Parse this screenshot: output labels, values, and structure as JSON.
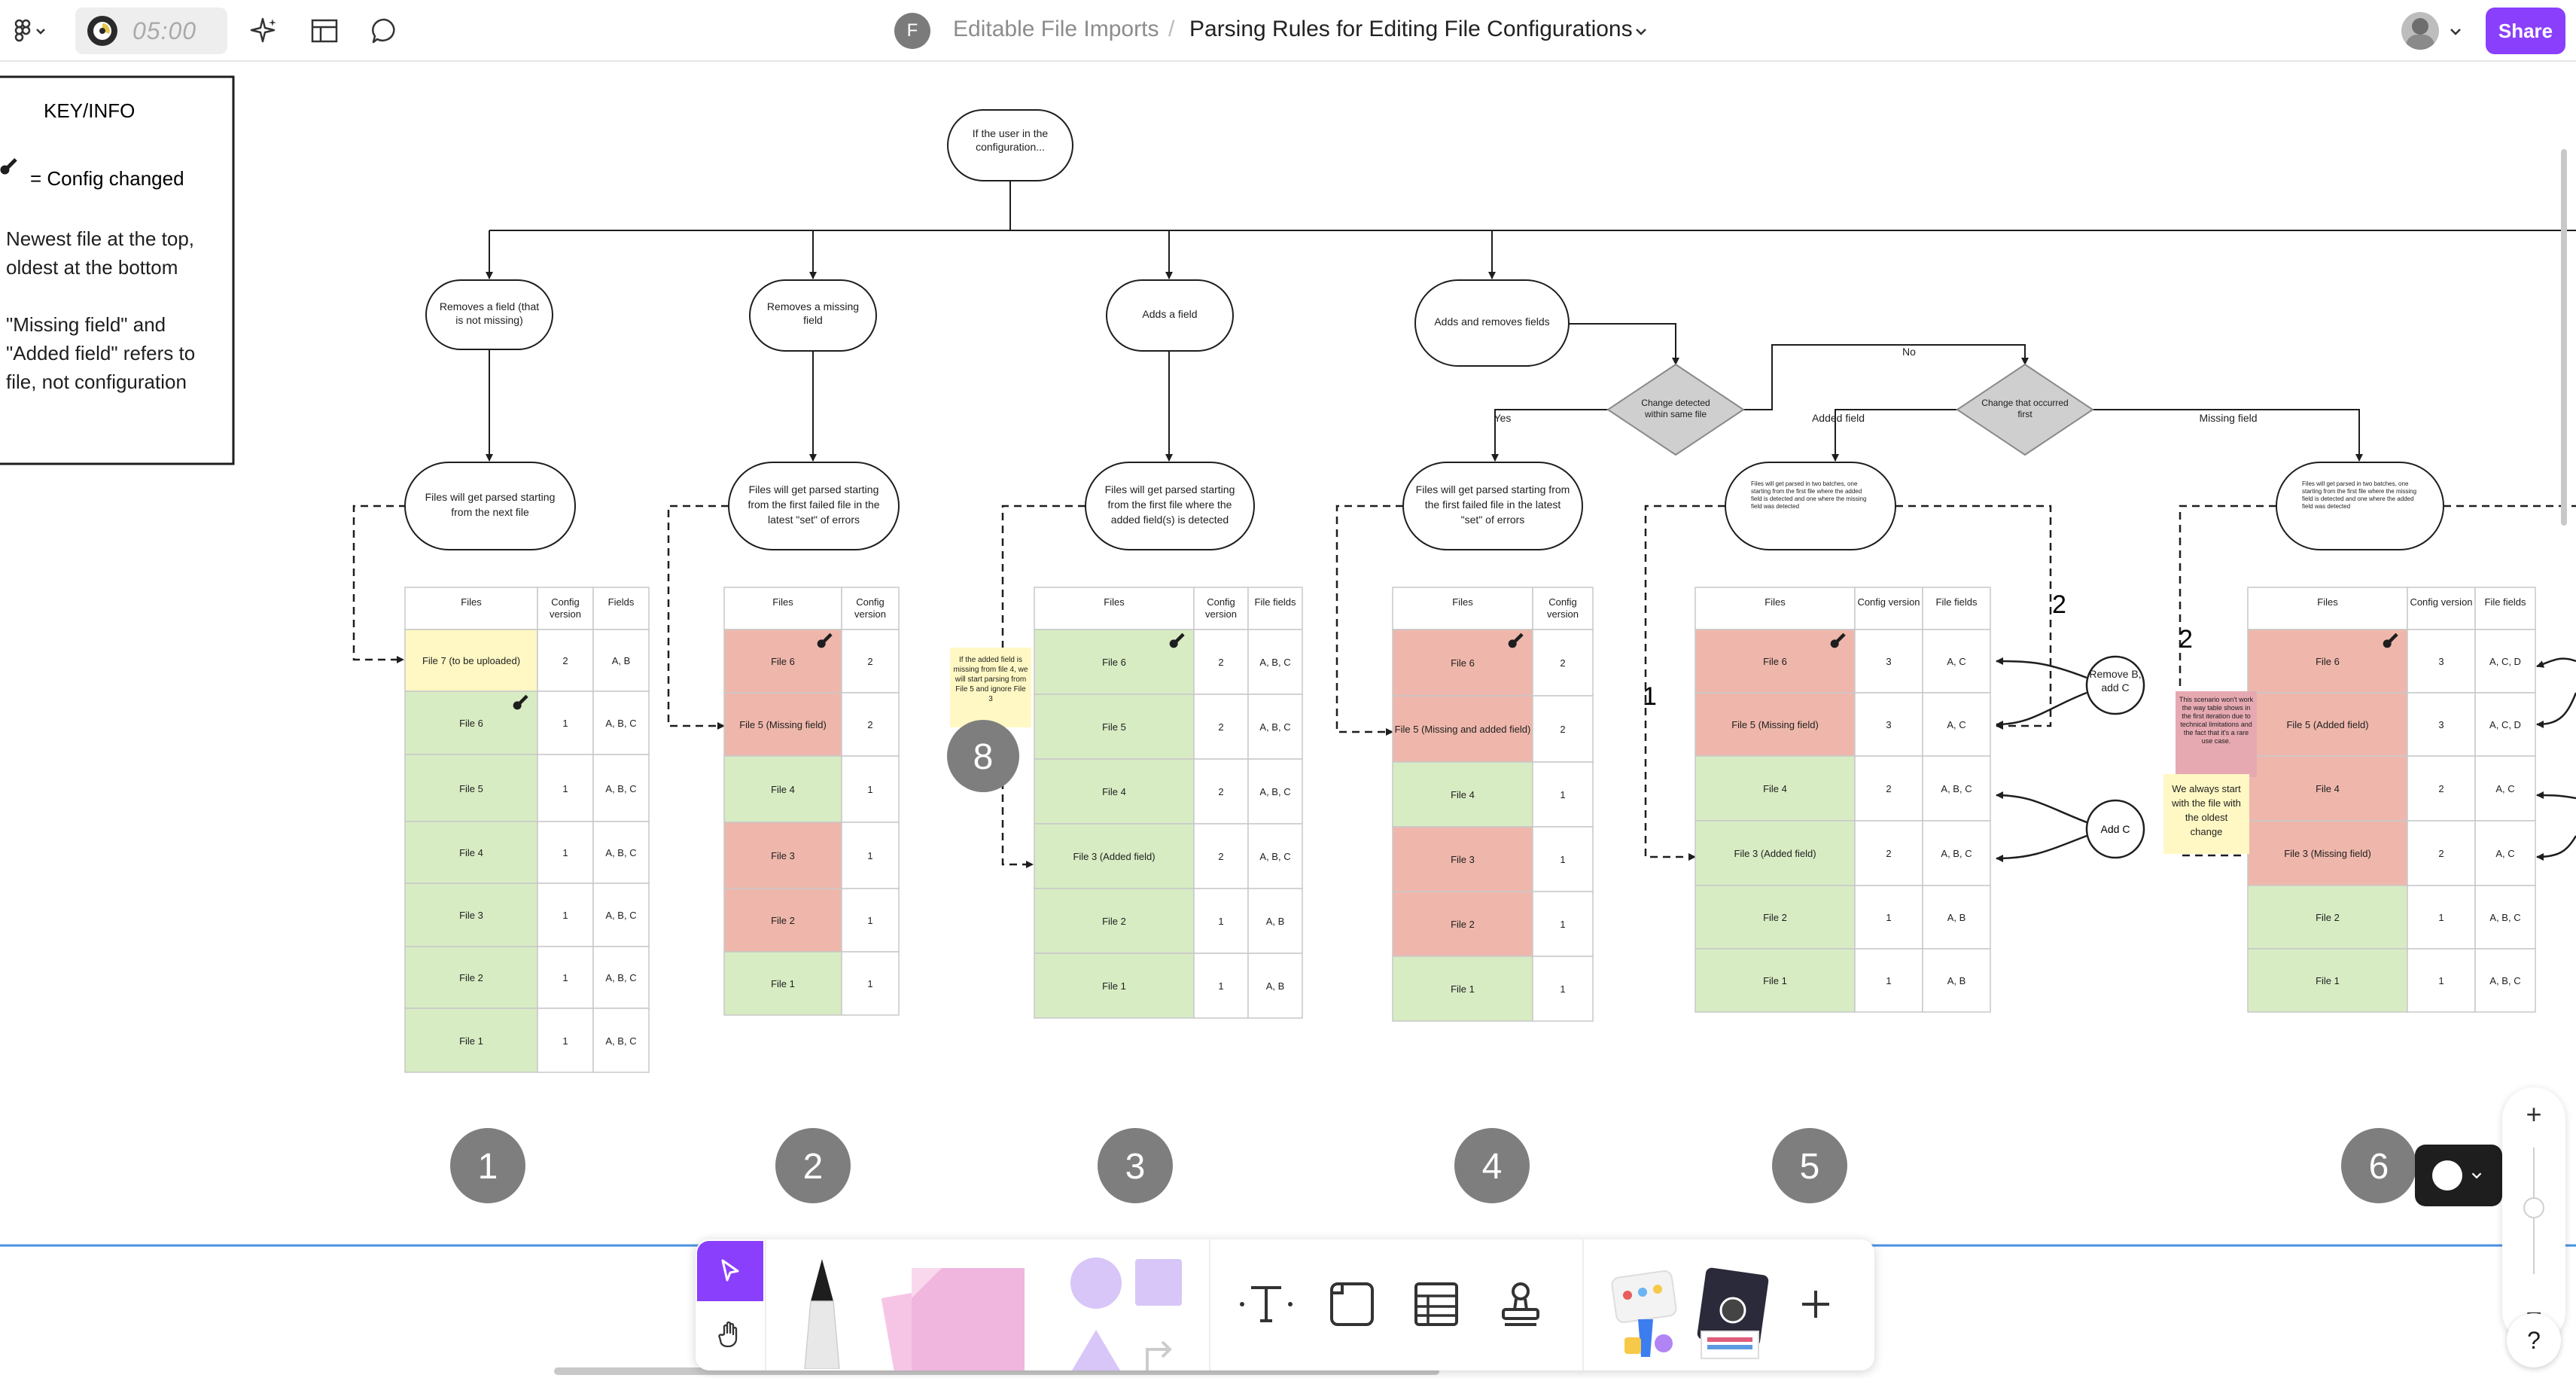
{
  "header": {
    "timer": "05:00",
    "team_initial": "F",
    "project": "Editable File Imports",
    "separator": "/",
    "file_title": "Parsing Rules for Editing File Configurations",
    "share_label": "Share"
  },
  "key": {
    "title": "KEY/INFO",
    "config_changed": "= Config changed",
    "order_note": "Newest file at the top, oldest at the bottom",
    "field_note": "\"Missing field\" and \"Added field\" refers to file, not configuration"
  },
  "flow": {
    "root": "If the user in the configuration...",
    "branches": [
      "Removes a field (that is not missing)",
      "Removes a missing field",
      "Adds a field",
      "Adds and removes fields"
    ],
    "diamond1": "Change detected within same file",
    "diamond2": "Change that occurred first",
    "labels": {
      "no": "No",
      "yes": "Yes",
      "added_field": "Added field",
      "missing_field": "Missing field"
    },
    "outcomes": [
      "Files will get parsed starting from the next file",
      "Files will get parsed starting from the first failed file in the latest \"set\" of errors",
      "Files will get parsed starting from the first file where the added field(s) is detected",
      "Files will get parsed starting from the first failed file in the latest \"set\" of errors",
      "Files will get parsed in two batches, one starting from the first file where the added field is detected and one where the missing field was detected",
      "Files will get parsed in two batches, one starting from the first file where the missing field is detected and one where the added field was detected"
    ]
  },
  "tables": [
    {
      "headers": [
        "Files",
        "Config version",
        "Fields"
      ],
      "rows": [
        [
          "File 7 (to be uploaded)",
          "2",
          "A, B"
        ],
        [
          "File 6",
          "1",
          "A, B, C"
        ],
        [
          "File 5",
          "1",
          "A, B, C"
        ],
        [
          "File 4",
          "1",
          "A, B, C"
        ],
        [
          "File 3",
          "1",
          "A, B, C"
        ],
        [
          "File 2",
          "1",
          "A, B, C"
        ],
        [
          "File 1",
          "1",
          "A, B, C"
        ]
      ]
    },
    {
      "headers": [
        "Files",
        "Config version"
      ],
      "rows": [
        [
          "File 6",
          "2"
        ],
        [
          "File 5 (Missing field)",
          "2"
        ],
        [
          "File 4",
          "1"
        ],
        [
          "File 3",
          "1"
        ],
        [
          "File 2",
          "1"
        ],
        [
          "File 1",
          "1"
        ]
      ]
    },
    {
      "headers": [
        "Files",
        "Config version",
        "File fields"
      ],
      "rows": [
        [
          "File 6",
          "2",
          "A, B, C"
        ],
        [
          "File 5",
          "2",
          "A, B, C"
        ],
        [
          "File 4",
          "2",
          "A, B, C"
        ],
        [
          "File 3 (Added field)",
          "2",
          "A, B, C"
        ],
        [
          "File 2",
          "1",
          "A, B"
        ],
        [
          "File 1",
          "1",
          "A, B"
        ]
      ]
    },
    {
      "headers": [
        "Files",
        "Config version"
      ],
      "rows": [
        [
          "File 6",
          "2"
        ],
        [
          "File 5 (Missing and added field)",
          "2"
        ],
        [
          "File 4",
          "1"
        ],
        [
          "File 3",
          "1"
        ],
        [
          "File 2",
          "1"
        ],
        [
          "File 1",
          "1"
        ]
      ]
    },
    {
      "headers": [
        "Files",
        "Config version",
        "File fields"
      ],
      "rows": [
        [
          "File 6",
          "3",
          "A, C"
        ],
        [
          "File 5 (Missing field)",
          "3",
          "A, C"
        ],
        [
          "File 4",
          "2",
          "A, B, C"
        ],
        [
          "File 3 (Added field)",
          "2",
          "A, B, C"
        ],
        [
          "File 2",
          "1",
          "A, B"
        ],
        [
          "File 1",
          "1",
          "A, B"
        ]
      ]
    },
    {
      "headers": [
        "Files",
        "Config version",
        "File fields"
      ],
      "rows": [
        [
          "File 6",
          "3",
          "A, C, D"
        ],
        [
          "File 5 (Added field)",
          "3",
          "A, C, D"
        ],
        [
          "File 4",
          "2",
          "A, C"
        ],
        [
          "File 3 (Missing field)",
          "2",
          "A, C"
        ],
        [
          "File 2",
          "1",
          "A, B, C"
        ],
        [
          "File 1",
          "1",
          "A, B, C"
        ]
      ]
    }
  ],
  "circles": {
    "remove_b_add_c": "Remove B, add C",
    "add_c": "Add C"
  },
  "batch_labels": {
    "two_a": "2",
    "one": "1",
    "two_b": "2"
  },
  "stickies": {
    "added_field_note": "If the added field is missing from file 4, we will start parsing from File 5 and ignore File 3",
    "scenario_note": "This scenario won't work the way table shows in the first iteration due to technical limitations and the fact that it's a rare use case.",
    "oldest_note": "We always start with the file with the oldest change"
  },
  "section_numbers": [
    "1",
    "2",
    "3",
    "4",
    "5",
    "6",
    "8"
  ],
  "colors": {
    "accent": "#8a3ffc",
    "green": "#d8ecc4",
    "red": "#efb7ac",
    "yellow": "#fff8c4",
    "gray": "#f2f2f2",
    "number_badge": "#7e7e7e"
  },
  "icons": [
    "figma-menu-icon",
    "timer-icon",
    "ai-sparkle-icon",
    "layout-icon",
    "comment-icon",
    "wrench-icon",
    "move-pointer-icon",
    "hand-icon",
    "marker-icon",
    "sticky-note-icon",
    "shapes-icon",
    "text-icon",
    "section-icon",
    "table-icon",
    "stamp-icon",
    "plus-icon",
    "help-icon"
  ],
  "zoom": {
    "in": "+",
    "out": "−",
    "help": "?"
  }
}
